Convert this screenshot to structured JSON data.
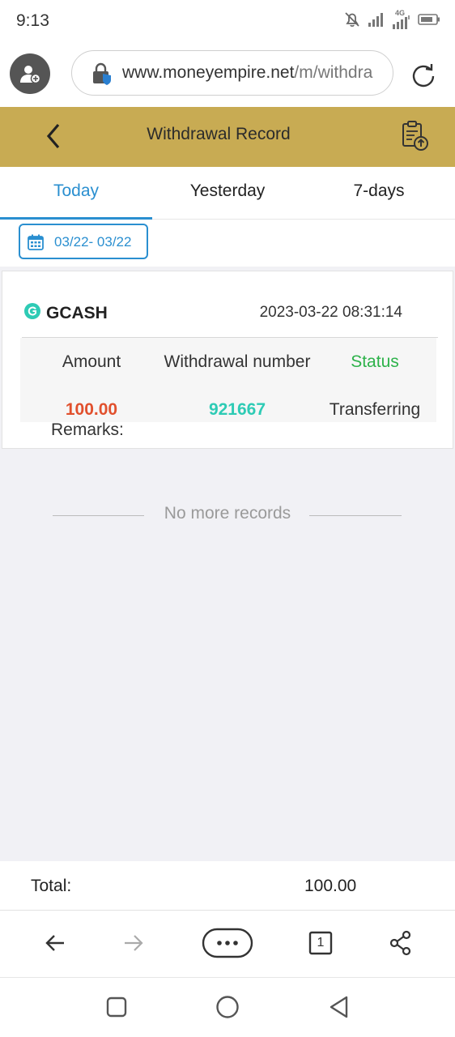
{
  "status_bar": {
    "time": "9:13",
    "network": "4G",
    "icons": [
      "mute-bell-icon",
      "signal-icon",
      "signal-4g-icon",
      "battery-icon"
    ]
  },
  "browser": {
    "url_domain": "www.moneyempire.net",
    "url_path": "/m/withdra",
    "icons": [
      "profile-avatar-icon",
      "lock-shield-icon",
      "reload-icon"
    ]
  },
  "header": {
    "title": "Withdrawal Record",
    "icons": [
      "back-arrow-icon",
      "clipboard-upload-icon"
    ],
    "background_color": "#c8ab53"
  },
  "tabs": [
    {
      "label": "Today",
      "active": true
    },
    {
      "label": "Yesterday",
      "active": false
    },
    {
      "label": "7-days",
      "active": false
    }
  ],
  "date_filter": {
    "label": "03/22- 03/22",
    "icon": "calendar-icon"
  },
  "record": {
    "method": "GCASH",
    "datetime": "2023-03-22 08:31:14",
    "columns": {
      "amount": "Amount",
      "number": "Withdrawal number",
      "status": "Status"
    },
    "values": {
      "amount": "100.00",
      "number": "921667",
      "status": "Transferring"
    },
    "remarks_label": "Remarks:"
  },
  "no_more_text": "No more records",
  "total": {
    "label": "Total:",
    "value": "100.00"
  },
  "browser_nav": {
    "tab_count": "1",
    "icons": [
      "back-icon",
      "forward-icon",
      "more-icon",
      "tabs-icon",
      "share-icon"
    ]
  },
  "android_nav": {
    "icons": [
      "recents-square-icon",
      "home-circle-icon",
      "back-triangle-icon"
    ]
  },
  "colors": {
    "accent_blue": "#2a8fd0",
    "amount_red": "#e1502d",
    "number_teal": "#2ecbb5",
    "status_green": "#2db24a"
  }
}
